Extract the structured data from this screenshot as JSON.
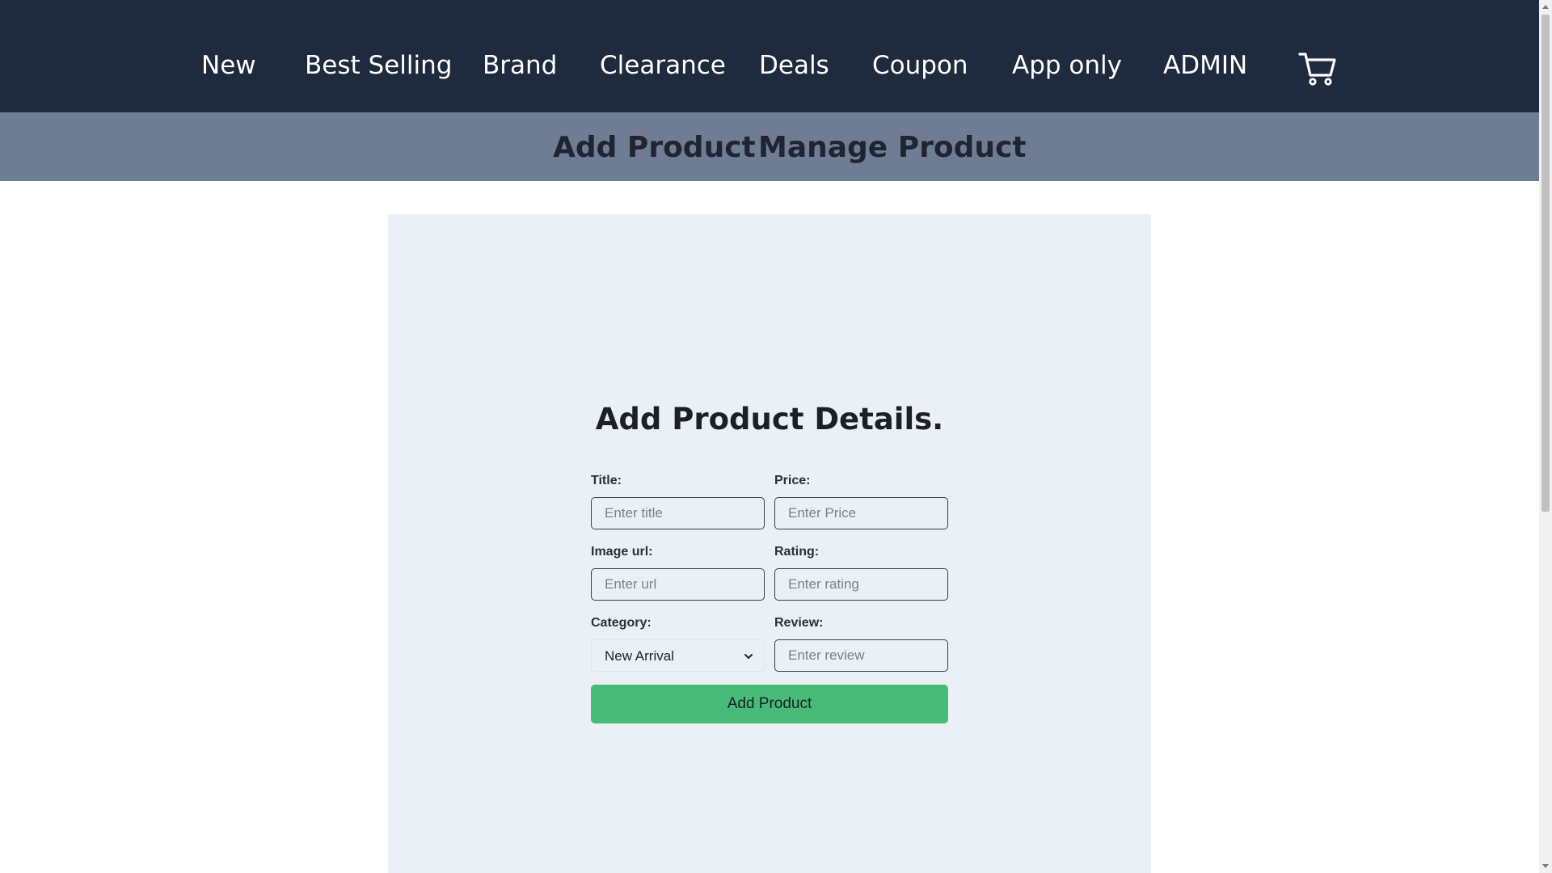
{
  "topnav": {
    "items": [
      {
        "label": "New"
      },
      {
        "label": "Best Selling"
      },
      {
        "label": "Brand"
      },
      {
        "label": "Clearance"
      },
      {
        "label": "Deals"
      },
      {
        "label": "Coupon"
      },
      {
        "label": "App only"
      },
      {
        "label": "ADMIN"
      }
    ],
    "cart_icon": "cart-icon"
  },
  "subnav": {
    "add_product": "Add Product",
    "manage_product": "Manage Product"
  },
  "form": {
    "title": "Add Product Details.",
    "fields": {
      "title": {
        "label": "Title:",
        "placeholder": "Enter title",
        "value": ""
      },
      "price": {
        "label": "Price:",
        "placeholder": "Enter Price",
        "value": ""
      },
      "image_url": {
        "label": "Image url:",
        "placeholder": "Enter url",
        "value": ""
      },
      "rating": {
        "label": "Rating:",
        "placeholder": "Enter rating",
        "value": ""
      },
      "category": {
        "label": "Category:",
        "selected": "New Arrival"
      },
      "review": {
        "label": "Review:",
        "placeholder": "Enter review",
        "value": ""
      }
    },
    "submit_label": "Add Product"
  },
  "colors": {
    "nav_bg": "#1e2a3e",
    "subnav_bg": "#6f7d94",
    "card_bg": "#ebeff6",
    "button_bg": "#48bb78"
  }
}
